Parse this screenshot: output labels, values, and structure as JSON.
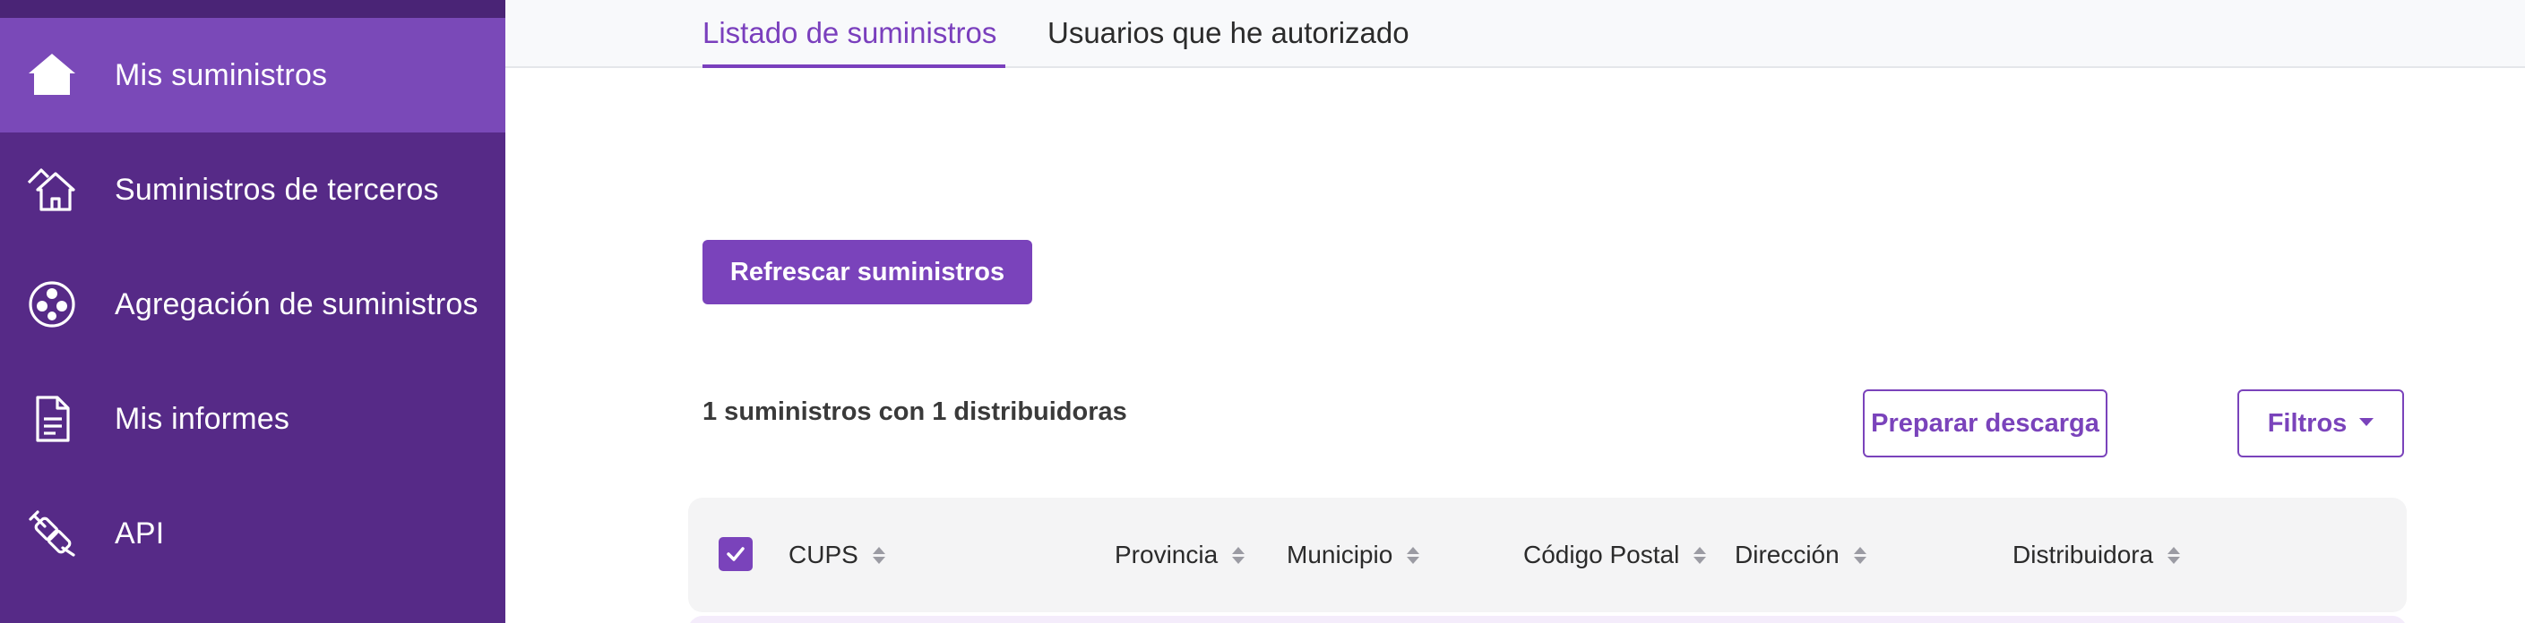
{
  "sidebar": {
    "items": [
      {
        "label": "Mis suministros",
        "icon": "home-icon",
        "active": true
      },
      {
        "label": "Suministros de terceros",
        "icon": "home-outline-icon",
        "active": false
      },
      {
        "label": "Agregación de suministros",
        "icon": "aggregation-icon",
        "active": false
      },
      {
        "label": "Mis informes",
        "icon": "document-icon",
        "active": false
      },
      {
        "label": "API",
        "icon": "plug-icon",
        "active": false
      }
    ]
  },
  "tabs": [
    {
      "label": "Listado de suministros",
      "active": true
    },
    {
      "label": "Usuarios que he autorizado",
      "active": false
    }
  ],
  "actions": {
    "refresh_label": "Refrescar suministros",
    "download_label": "Preparar descarga",
    "filters_label": "Filtros"
  },
  "summary": "1 suministros con 1 distribuidoras",
  "table": {
    "columns": [
      "CUPS",
      "Provincia",
      "Municipio",
      "Código Postal",
      "Dirección",
      "Distribuidora"
    ],
    "select_all_checked": true
  },
  "colors": {
    "sidebar_bg": "#562a87",
    "sidebar_active": "#7a49b8",
    "accent": "#7a43bb"
  }
}
